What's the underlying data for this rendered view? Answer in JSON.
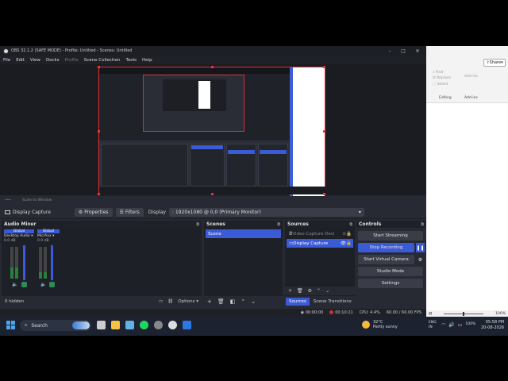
{
  "window": {
    "title": "OBS 32.1.2 (SAFE MODE) - Profile: Untitled - Scenes: Untitled",
    "minimize": "–",
    "maximize": "□",
    "close": "✕"
  },
  "menu": [
    "File",
    "Edit",
    "View",
    "Docks",
    "Profile",
    "Scene Collection",
    "Tools",
    "Help"
  ],
  "preview_toolbar": {
    "left": "•••",
    "mode": "Scale to Window"
  },
  "source_toolbar": {
    "source_name": "Display Capture",
    "properties": "Properties",
    "filters": "Filters",
    "display_label": "Display",
    "display_value": ": 1920x1080 @ 0,0 (Primary Monitor)"
  },
  "mixer": {
    "title": "Audio Mixer",
    "channels": [
      {
        "global": "Global",
        "name": "Desktop Audio",
        "db": "0.0 dB",
        "level": 0.35,
        "color": "#2a7f3a"
      },
      {
        "global": "Global",
        "name": "Mic/Aux",
        "db": "0.0 dB",
        "level": 0.2,
        "color": "#2a7f3a"
      }
    ],
    "hidden": "0 hidden",
    "options": "Options"
  },
  "scenes": {
    "title": "Scenes",
    "items": [
      "Scene"
    ]
  },
  "sources": {
    "title": "Sources",
    "items": [
      {
        "name": "Video Capture Devi",
        "active": false
      },
      {
        "name": "Display Capture",
        "active": true
      }
    ],
    "tab_sources": "Sources",
    "tab_transitions": "Scene Transitions"
  },
  "controls": {
    "title": "Controls",
    "start_streaming": "Start Streaming",
    "stop_recording": "Stop Recording",
    "start_virtual_camera": "Start Virtual Camera",
    "studio_mode": "Studio Mode",
    "settings": "Settings",
    "pause": "❚❚",
    "gear": "⚙"
  },
  "status": {
    "stream_time": "00:00:00",
    "rec_time": "00:10:21",
    "cpu": "CPU: 4.4%",
    "fps": "60.00 / 60.00 FPS"
  },
  "right_app": {
    "share": "Share",
    "find": "Find",
    "replace": "Replace",
    "select": "Select",
    "add_ins": "Add-ins",
    "editing": "Editing",
    "add_ins_label": "Add-ins",
    "zoom": "100%"
  },
  "taskbar": {
    "search": "Search",
    "temp": "32°C",
    "weather": "Partly sunny",
    "lang1": "ENG",
    "lang2": "IN",
    "battery": "100%",
    "time": "05:58 PM",
    "date": "20-08-2026"
  },
  "colors": {
    "accent": "#3b5ad6",
    "record": "#cc3333"
  }
}
